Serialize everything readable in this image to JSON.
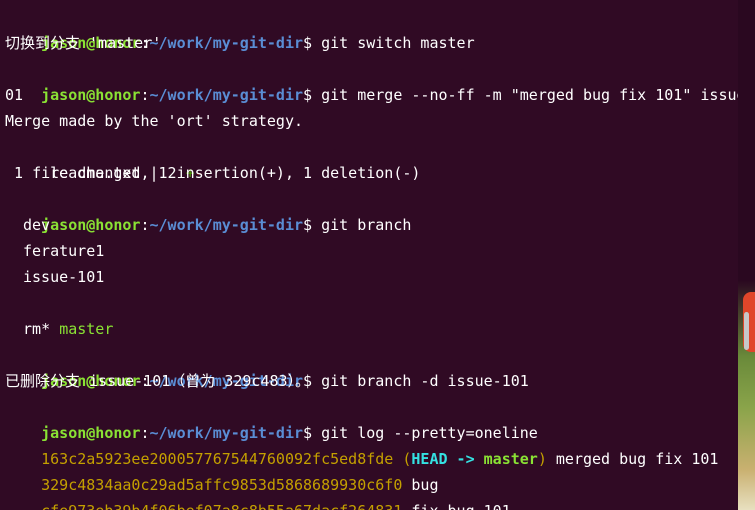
{
  "prompt": {
    "user": "jason@honor",
    "sep": ":",
    "path": "~/work/my-git-dir",
    "sign": "$ "
  },
  "lines": {
    "cmd1": "git switch master",
    "out1": "切换到分支 'master'",
    "cmd2": "git merge --no-ff -m \"merged bug fix 101\" issue-1",
    "cmd2b": "01",
    "out2a": "Merge made by the 'ort' strategy.",
    "stat_file": " readme.txt | 2 ",
    "stat_plus": "+",
    "stat_minus": "-",
    "stat_summary": " 1 file changed, 1 insertion(+), 1 deletion(-)",
    "cmd3": "git branch",
    "branches": [
      "dev",
      "ferature1",
      "issue-101",
      "master",
      "rm"
    ],
    "current_marker": "* ",
    "cmd4": "git branch -d issue-101",
    "out4": "已删除分支 issue-101（曾为 329c483）。",
    "cmd5": "git log --pretty=oneline",
    "log": [
      {
        "hash": "163c2a5923ee200057767544760092fc5ed8fde",
        "msg": "merged bug fix 101"
      },
      {
        "hash": "329c4834aa0c29ad5affc9853d5868689930c6f0",
        "msg": "bug"
      },
      {
        "hash": "cfe973eb39b4f06bef07a8c8b55a67dacf264831",
        "msg": "fix bug 101"
      }
    ],
    "log_decor_open": " (",
    "log_decor_head": "HEAD",
    "log_decor_arrow": " -> ",
    "log_decor_branch": "master",
    "log_decor_close": ") "
  },
  "colors": {
    "background": "#300a24",
    "prompt_user": "#8ae234",
    "prompt_path": "#5a8dd4",
    "commit_hash": "#c4a000",
    "head_label": "#34e2e2"
  }
}
